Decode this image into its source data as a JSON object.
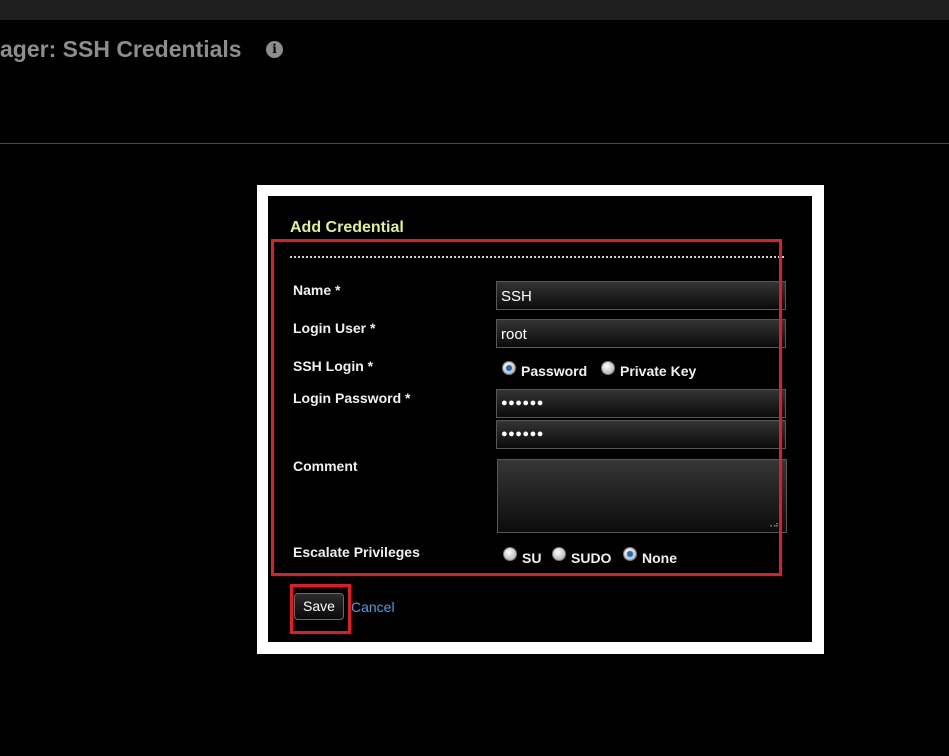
{
  "header": {
    "title": "ager: SSH Credentials",
    "info_icon": "info-icon"
  },
  "dialog": {
    "title": "Add Credential",
    "fields": {
      "name": {
        "label": "Name *",
        "value": "SSH"
      },
      "login_user": {
        "label": "Login User *",
        "value": "root"
      },
      "ssh_login": {
        "label": "SSH Login *",
        "options": [
          {
            "label": "Password",
            "checked": true
          },
          {
            "label": "Private Key",
            "checked": false
          }
        ]
      },
      "login_password": {
        "label": "Login Password *",
        "value": "●●●●●●",
        "confirm_value": "●●●●●●"
      },
      "comment": {
        "label": "Comment",
        "value": ""
      },
      "escalate": {
        "label": "Escalate Privileges",
        "options": [
          {
            "label": "SU",
            "checked": false
          },
          {
            "label": "SUDO",
            "checked": false
          },
          {
            "label": "None",
            "checked": true
          }
        ]
      }
    },
    "save_label": "Save",
    "cancel_label": "Cancel"
  },
  "colors": {
    "background": "#000000",
    "title_accent": "#e4f08c",
    "highlight": "#e11c25",
    "link": "#4a9ee6"
  }
}
